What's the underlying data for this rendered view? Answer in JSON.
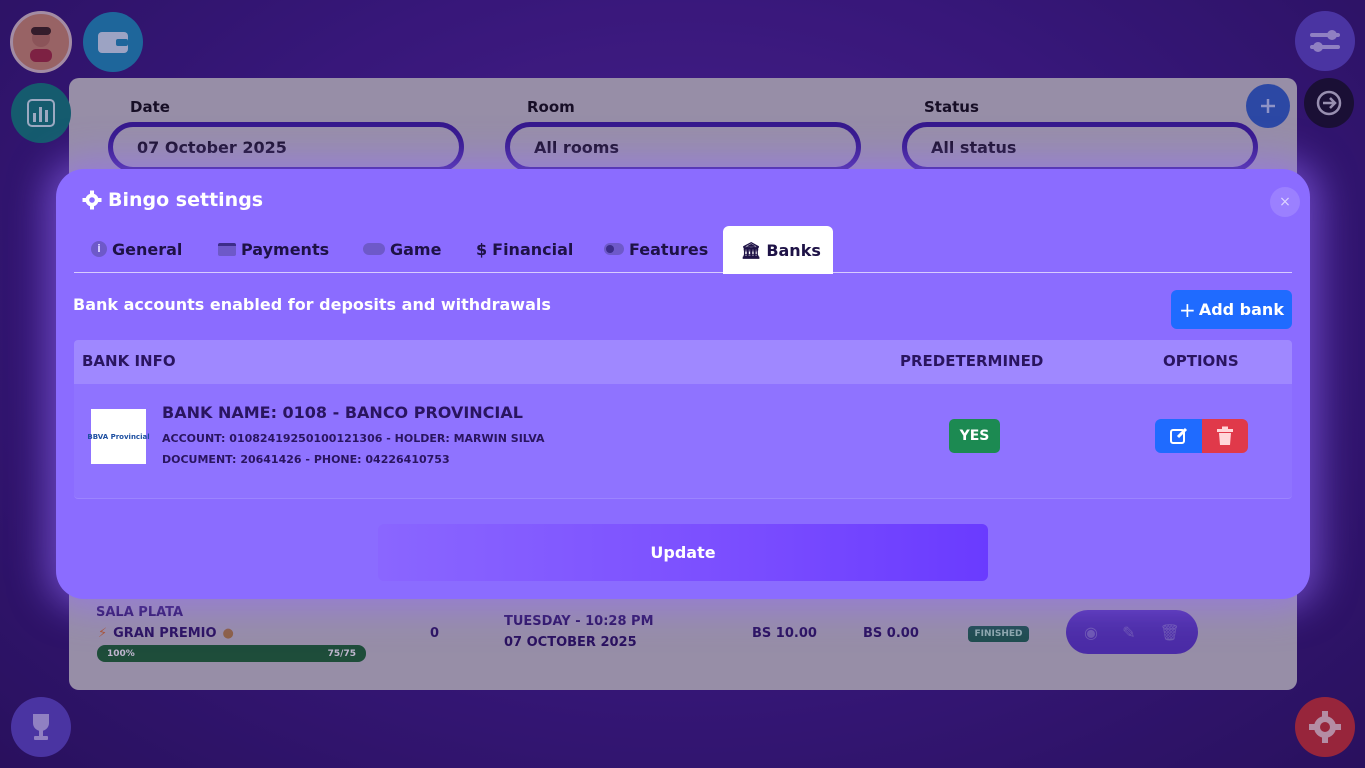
{
  "filters": {
    "date": {
      "label": "Date",
      "value": "07 October 2025"
    },
    "room": {
      "label": "Room",
      "value": "All rooms"
    },
    "status": {
      "label": "Status",
      "value": "All status"
    }
  },
  "background_row": {
    "room": "SALA PLATA",
    "prize": "GRAN PREMIO",
    "progress_percent": "100%",
    "progress_count": "75/75",
    "progress_fraction": 1.0,
    "count": "0",
    "day_time": "TUESDAY - 10:28 PM",
    "date": "07 OCTOBER 2025",
    "amount1": "BS 10.00",
    "amount2": "BS 0.00",
    "status": "FINISHED"
  },
  "modal": {
    "title": "Bingo settings",
    "close": "×",
    "tabs": [
      {
        "label": "General",
        "icon": "info-icon"
      },
      {
        "label": "Payments",
        "icon": "credit-card-icon"
      },
      {
        "label": "Game",
        "icon": "gamepad-icon"
      },
      {
        "label": "Financial",
        "icon": "dollar-icon"
      },
      {
        "label": "Features",
        "icon": "toggle-icon"
      },
      {
        "label": "Banks",
        "icon": "bank-icon",
        "active": true
      }
    ],
    "subtitle": "Bank accounts enabled for deposits and withdrawals",
    "add_button": "Add bank",
    "table": {
      "headers": [
        "BANK INFO",
        "PREDETERMINED",
        "OPTIONS"
      ],
      "rows": [
        {
          "logo_text": "BBVA Provincial",
          "bank_name": "BANK NAME: 0108 - BANCO PROVINCIAL",
          "account_label": "ACCOUNT:",
          "account": "01082419250100121306",
          "holder_label": "HOLDER:",
          "holder": "MARWIN SILVA",
          "document_label": "DOCUMENT:",
          "document": "20641426",
          "phone_label": "PHONE:",
          "phone": "04226410753",
          "predetermined": "YES"
        }
      ]
    },
    "update_button": "Update"
  },
  "colors": {
    "modal_bg": "#8b6cff",
    "primary_blue": "#1f6bff",
    "danger_red": "#e0394a",
    "success_green": "#1c8a52"
  }
}
